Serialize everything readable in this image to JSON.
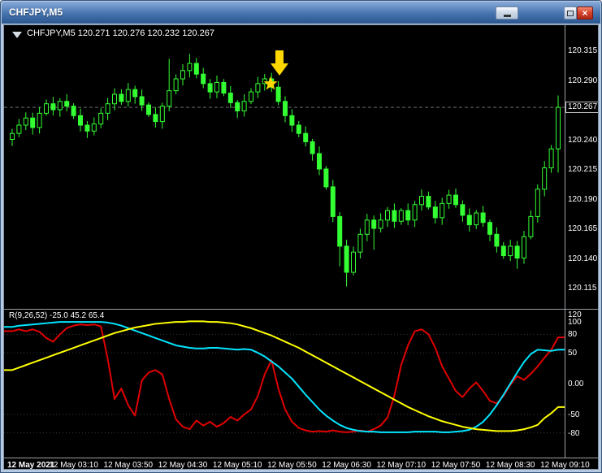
{
  "window": {
    "title": "CHFJPY,M5",
    "controls": {
      "close_glyph": "×"
    }
  },
  "chart": {
    "symbol_ohlc_label": "CHFJPY,M5 120.271 120.276 120.232 120.267",
    "indicator_label": "R(9,26,52) -25.0 45.2 65.4",
    "current_price": "120.267"
  },
  "chart_data": {
    "type": "candlestick",
    "symbol": "CHFJPY",
    "timeframe": "M5",
    "ohlc_display": {
      "open": "120.271",
      "high": "120.276",
      "low": "120.232",
      "close": "120.267"
    },
    "current_price": 120.267,
    "price_axis_labels": [
      "120.315",
      "120.290",
      "120.240",
      "120.215",
      "120.190",
      "120.165",
      "120.140",
      "120.115"
    ],
    "time_axis_labels": [
      "12 May 2021",
      "12 May 03:10",
      "12 May 03:50",
      "12 May 04:30",
      "12 May 05:10",
      "12 May 05:50",
      "12 May 06:30",
      "12 May 07:10",
      "12 May 07:50",
      "12 May 08:30",
      "12 May 09:10"
    ],
    "candles": {
      "color": "#33ff33",
      "first_open": 120.24,
      "closes": [
        120.245,
        120.252,
        120.258,
        120.25,
        120.262,
        120.27,
        120.265,
        120.272,
        120.268,
        120.26,
        120.252,
        120.247,
        120.253,
        120.262,
        120.27,
        120.278,
        120.272,
        120.282,
        120.276,
        120.269,
        120.261,
        120.255,
        120.268,
        120.281,
        120.291,
        120.298,
        120.304,
        120.295,
        120.287,
        120.28,
        120.288,
        120.279,
        120.271,
        120.264,
        120.272,
        120.28,
        120.287,
        120.291,
        120.284,
        120.272,
        120.26,
        120.252,
        120.245,
        120.238,
        120.228,
        120.215,
        120.2,
        120.175,
        120.15,
        120.128,
        120.145,
        120.16,
        120.172,
        120.165,
        120.172,
        120.18,
        120.171,
        120.18,
        120.172,
        120.185,
        120.192,
        120.183,
        120.174,
        120.186,
        120.193,
        120.185,
        120.176,
        120.168,
        120.178,
        120.17,
        120.16,
        120.15,
        120.142,
        120.15,
        120.14,
        120.158,
        120.175,
        120.198,
        120.216,
        120.232,
        120.267
      ],
      "wick_overrides": {
        "23": {
          "high": 120.308
        },
        "26": {
          "high": 120.312
        },
        "48": {
          "low": 120.133
        },
        "49": {
          "low": 120.116
        },
        "53": {
          "low": 120.147
        },
        "74": {
          "low": 120.131
        },
        "80": {
          "high": 120.277,
          "low": 120.212
        }
      }
    },
    "oscillator": {
      "label": "R(9,26,52) -25.0 45.2 65.4",
      "axis_labels": [
        "120",
        "100",
        "80",
        "50",
        "0.00",
        "-50",
        "-80"
      ],
      "level_lines": [
        80,
        50,
        -50,
        -80
      ],
      "series": [
        {
          "name": "red",
          "color": "#e00000",
          "width": 2,
          "values": [
            85,
            88,
            85,
            88,
            84,
            74,
            68,
            80,
            90,
            94,
            96,
            95,
            96,
            93,
            40,
            -25,
            -8,
            -35,
            -52,
            5,
            18,
            22,
            15,
            -25,
            -58,
            -70,
            -74,
            -60,
            -68,
            -62,
            -70,
            -64,
            -54,
            -60,
            -50,
            -42,
            -20,
            15,
            38,
            -8,
            -42,
            -62,
            -72,
            -76,
            -78,
            -77,
            -78,
            -76,
            -78,
            -79,
            -78,
            -76,
            -78,
            -74,
            -68,
            -55,
            -20,
            30,
            62,
            85,
            88,
            80,
            58,
            28,
            8,
            -12,
            -22,
            -8,
            2,
            -12,
            -28,
            -32,
            -20,
            -2,
            12,
            6,
            16,
            28,
            42,
            55,
            75
          ]
        },
        {
          "name": "cyan",
          "color": "#00e5ff",
          "width": 2,
          "values": [
            92,
            94,
            95,
            96,
            97,
            98,
            99,
            100,
            100,
            100,
            100,
            100,
            100,
            100,
            99,
            97,
            94,
            90,
            86,
            82,
            78,
            74,
            70,
            66,
            62,
            60,
            58,
            57,
            57,
            58,
            58,
            57,
            56,
            55,
            56,
            55,
            50,
            44,
            36,
            28,
            18,
            8,
            -5,
            -18,
            -30,
            -42,
            -52,
            -60,
            -67,
            -72,
            -75,
            -77,
            -78,
            -78,
            -79,
            -79,
            -79,
            -79,
            -79,
            -78,
            -78,
            -78,
            -78,
            -79,
            -79,
            -78,
            -77,
            -75,
            -70,
            -62,
            -50,
            -35,
            -18,
            0,
            18,
            35,
            48,
            55,
            54,
            53,
            55
          ]
        },
        {
          "name": "yellow",
          "color": "#ffff00",
          "width": 2,
          "values": [
            22,
            26,
            30,
            34,
            38,
            42,
            46,
            50,
            54,
            58,
            62,
            66,
            70,
            74,
            78,
            82,
            85,
            88,
            91,
            93,
            95,
            97,
            98,
            99,
            100,
            100,
            101,
            101,
            101,
            100,
            100,
            99,
            98,
            96,
            93,
            90,
            86,
            82,
            78,
            73,
            68,
            63,
            58,
            52,
            46,
            40,
            34,
            28,
            22,
            16,
            10,
            4,
            -2,
            -8,
            -14,
            -20,
            -26,
            -32,
            -38,
            -43,
            -48,
            -53,
            -57,
            -61,
            -64,
            -67,
            -70,
            -72,
            -74,
            -75,
            -76,
            -77,
            -77,
            -77,
            -76,
            -74,
            -71,
            -67,
            -56,
            -48,
            -38
          ]
        }
      ]
    },
    "annotations": [
      {
        "type": "arrow-down",
        "color": "#ffd700"
      },
      {
        "type": "star",
        "color": "#ffd700"
      }
    ]
  }
}
